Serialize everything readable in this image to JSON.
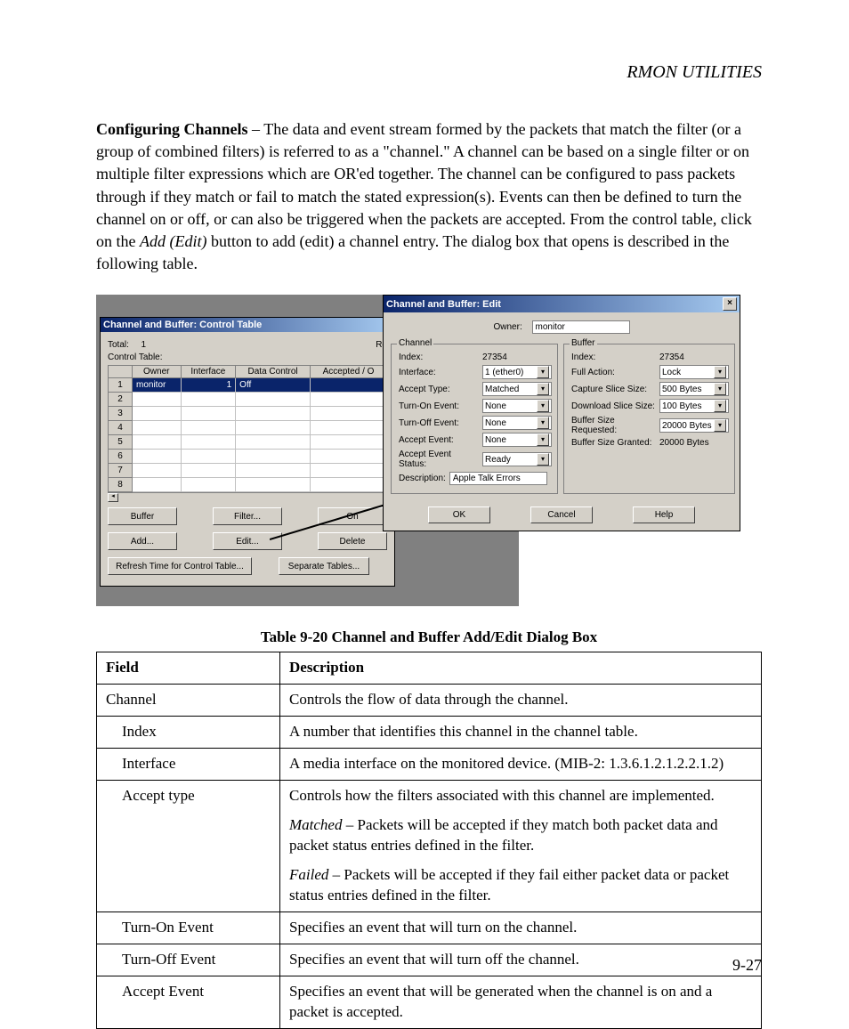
{
  "header": "RMON UTILITIES",
  "para_lead": "Configuring Channels",
  "para": " – The data and event stream formed by the packets that match the filter (or a group of combined filters) is referred to as a \"channel.\" A channel can be based on a single filter or on multiple filter expressions which are OR'ed together. The channel can be configured to pass packets through if they match or fail to match the stated expression(s). Events can then be defined to turn the channel on or off, or can also be triggered when the packets are accepted. From the control table, click on the ",
  "para_italic": "Add (Edit)",
  "para_tail": " button to add (edit) a channel entry. The dialog box that opens is described in the following table.",
  "ctrl": {
    "title": "Channel and Buffer: Control Table",
    "total_lbl": "Total:",
    "total_val": "1",
    "ctlabel": "Control Table:",
    "cols": [
      "",
      "Owner",
      "Interface",
      "Data Control",
      "Accepted / O"
    ],
    "rows": [
      {
        "n": "1",
        "owner": "monitor",
        "iface": "1",
        "dc": "Off",
        "acc": ""
      },
      {
        "n": "2"
      },
      {
        "n": "3"
      },
      {
        "n": "4"
      },
      {
        "n": "5"
      },
      {
        "n": "6"
      },
      {
        "n": "7"
      },
      {
        "n": "8"
      }
    ],
    "re": "Re",
    "btns1": [
      "Buffer",
      "Filter...",
      "On"
    ],
    "btns2": [
      "Add...",
      "Edit...",
      "Delete"
    ],
    "btns3": [
      "Refresh Time for Control Table...",
      "Separate Tables..."
    ]
  },
  "edit": {
    "title": "Channel and Buffer: Edit",
    "owner_lbl": "Owner:",
    "owner_val": "monitor",
    "channel": {
      "legend": "Channel",
      "index_lbl": "Index:",
      "index_val": "27354",
      "iface_lbl": "Interface:",
      "iface_val": "1 (ether0)",
      "accept_lbl": "Accept Type:",
      "accept_val": "Matched",
      "ton_lbl": "Turn-On Event:",
      "ton_val": "None",
      "toff_lbl": "Turn-Off Event:",
      "toff_val": "None",
      "aev_lbl": "Accept Event:",
      "aev_val": "None",
      "aes_lbl": "Accept Event Status:",
      "aes_val": "Ready",
      "desc_lbl": "Description:",
      "desc_val": "Apple Talk Errors"
    },
    "buffer": {
      "legend": "Buffer",
      "index_lbl": "Index:",
      "index_val": "27354",
      "full_lbl": "Full Action:",
      "full_val": "Lock",
      "cap_lbl": "Capture Slice Size:",
      "cap_val": "500 Bytes",
      "dl_lbl": "Download Slice Size:",
      "dl_val": "100 Bytes",
      "req_lbl": "Buffer Size Requested:",
      "req_val": "20000 Bytes",
      "grant_lbl": "Buffer Size Granted:",
      "grant_val": "20000 Bytes"
    },
    "ok": "OK",
    "cancel": "Cancel",
    "help": "Help"
  },
  "caption": "Table 9-20  Channel and Buffer Add/Edit Dialog Box",
  "thead": {
    "field": "Field",
    "desc": "Description"
  },
  "tbody": [
    {
      "f": "Channel",
      "d": "Controls the flow of data through the channel."
    },
    {
      "f": "Index",
      "indent": true,
      "d": "A number that identifies this channel in the channel table."
    },
    {
      "f": "Interface",
      "indent": true,
      "d": "A media interface on the monitored device. (MIB-2: 1.3.6.1.2.1.2.2.1.2)"
    },
    {
      "f": "Accept type",
      "indent": true,
      "d": "Controls how the filters associated with this channel are implemented.",
      "extra": [
        {
          "i": "Matched",
          "t": " – Packets will be accepted if they match both packet data and packet status entries defined in the filter."
        },
        {
          "i": "Failed",
          "t": " – Packets will be accepted if they fail either packet data or packet status entries defined in the filter."
        }
      ]
    },
    {
      "f": "Turn-On Event",
      "indent": true,
      "d": "Specifies an event that will turn on the channel."
    },
    {
      "f": "Turn-Off Event",
      "indent": true,
      "d": "Specifies an event that will turn off the channel."
    },
    {
      "f": "Accept Event",
      "indent": true,
      "d": "Specifies an event that will be generated when the channel is on and a packet is accepted."
    }
  ],
  "pagenum": "9-27"
}
